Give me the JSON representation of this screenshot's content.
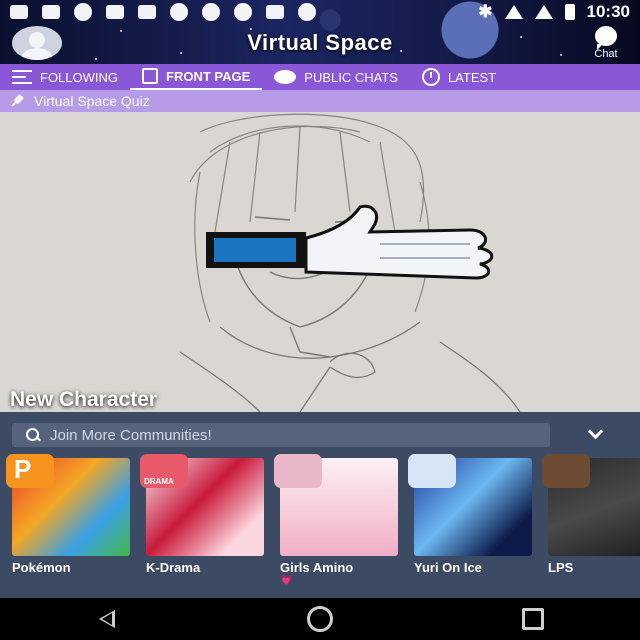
{
  "status_bar": {
    "time": "10:30"
  },
  "header": {
    "title": "Virtual Space",
    "chat_label": "Chat"
  },
  "tabs": [
    {
      "label": "FOLLOWING",
      "icon": "list-icon"
    },
    {
      "label": "FRONT PAGE",
      "icon": "page-icon",
      "active": true
    },
    {
      "label": "PUBLIC CHATS",
      "icon": "chat-bubbles-icon"
    },
    {
      "label": "LATEST",
      "icon": "clock-icon"
    }
  ],
  "pinned": {
    "label": "Virtual Space Quiz",
    "icon": "pin-icon"
  },
  "feature": {
    "title": "New Character",
    "image": "pencil-sketch-character-with-thumbs-up-sticker"
  },
  "communities": {
    "search_placeholder": "Join More Communities!",
    "items": [
      {
        "name": "Pokémon",
        "color": "#f7941d"
      },
      {
        "name": "K-Drama",
        "badge_text": "DRAMA",
        "color": "#e85a6a"
      },
      {
        "name": "Girls Amino",
        "extra": "💗",
        "color": "#e9b7c8"
      },
      {
        "name": "Yuri On Ice",
        "color": "#d7e6f6"
      },
      {
        "name": "LPS",
        "color": "#6e4b33"
      }
    ]
  },
  "navbar": {
    "buttons": [
      "back-icon",
      "home-icon",
      "recents-icon"
    ]
  },
  "colors": {
    "tab_bar": "#8a57d6",
    "pinned_bar": "#b69be8",
    "panel_bg": "#3d4a63",
    "search_bg": "#56637c"
  }
}
